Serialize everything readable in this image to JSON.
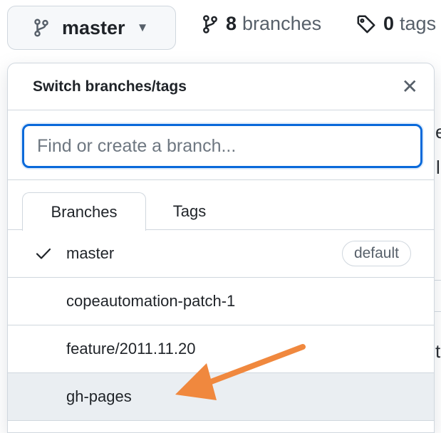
{
  "topbar": {
    "branch_button": "master",
    "branches_count": "8",
    "branches_label": "branches",
    "tags_count": "0",
    "tags_label": "tags"
  },
  "background_peek": [
    "e",
    "l",
    "t"
  ],
  "dropdown": {
    "title": "Switch branches/tags",
    "filter_placeholder": "Find or create a branch...",
    "tabs": [
      "Branches",
      "Tags"
    ],
    "branches": [
      {
        "name": "master",
        "checked": true,
        "badge": "default"
      },
      {
        "name": "copeautomation-patch-1"
      },
      {
        "name": "feature/2011.11.20"
      },
      {
        "name": "gh-pages",
        "highlighted": true
      }
    ]
  },
  "annotation": {
    "arrow_color": "#f0883e"
  },
  "colors": {
    "accent": "#0969da",
    "border": "#d0d7de",
    "muted": "#57606a"
  }
}
